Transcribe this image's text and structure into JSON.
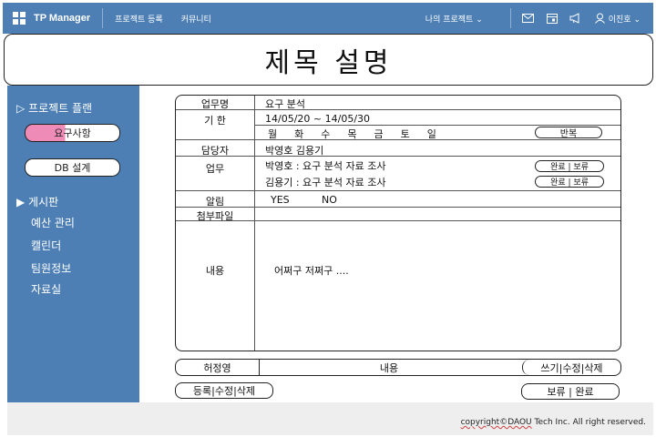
{
  "topbar": {
    "app_name": "TP Manager",
    "menu": [
      "프로젝트 등록",
      "커뮤니티"
    ],
    "my_projects": "나의 프로젝트 ⌄",
    "user_name": "이진호 ⌄"
  },
  "page_title": "제목 설명",
  "sidebar": {
    "project_plan": "▷ 프로젝트 플랜",
    "requirements": "요구사항",
    "db_design": "DB 설계",
    "board": "▶ 게시판",
    "items": [
      "예산 관리",
      "캘린더",
      "팀원정보",
      "자료실"
    ]
  },
  "form": {
    "labels": {
      "task_name": "업무명",
      "period": "기    한",
      "owner": "담당자",
      "task": "업무",
      "alarm": "알림",
      "attachment": "첨부파일",
      "content": "내용"
    },
    "task_name": "요구 분석",
    "period": "14/05/20 ~ 14/05/30",
    "weekdays": [
      "월",
      "화",
      "수",
      "목",
      "금",
      "토",
      "일"
    ],
    "repeat_label": "반복",
    "owners": "박영호 김용기",
    "tasks": [
      {
        "text": "박영호 : 요구 분석 자료 조사",
        "status": "완료 | 보류"
      },
      {
        "text": "김용기 : 요구 분석 자료 조사",
        "status": "완료 | 보류"
      }
    ],
    "alarm_yes": "YES",
    "alarm_no": "NO",
    "content_text": "어쩌구 저쩌구 ...."
  },
  "comment_bar": {
    "writer": "허정영",
    "content": "내용",
    "actions": "쓰기|수정|삭제"
  },
  "bottom_actions": {
    "left": "등록|수정|삭제",
    "right": "보류  |  완료"
  },
  "footer": {
    "copyright_prefix": "copyright©DAOU",
    "copyright_rest": " Tech Inc. All right reserved."
  },
  "colors": {
    "accent": "#4d7fb5",
    "highlight": "#ef8bb7",
    "footer_bg": "#eeeeee"
  },
  "icons": [
    "grid-icon",
    "mail-icon",
    "calendar-icon",
    "megaphone-icon",
    "user-icon",
    "chevron-down-icon"
  ]
}
